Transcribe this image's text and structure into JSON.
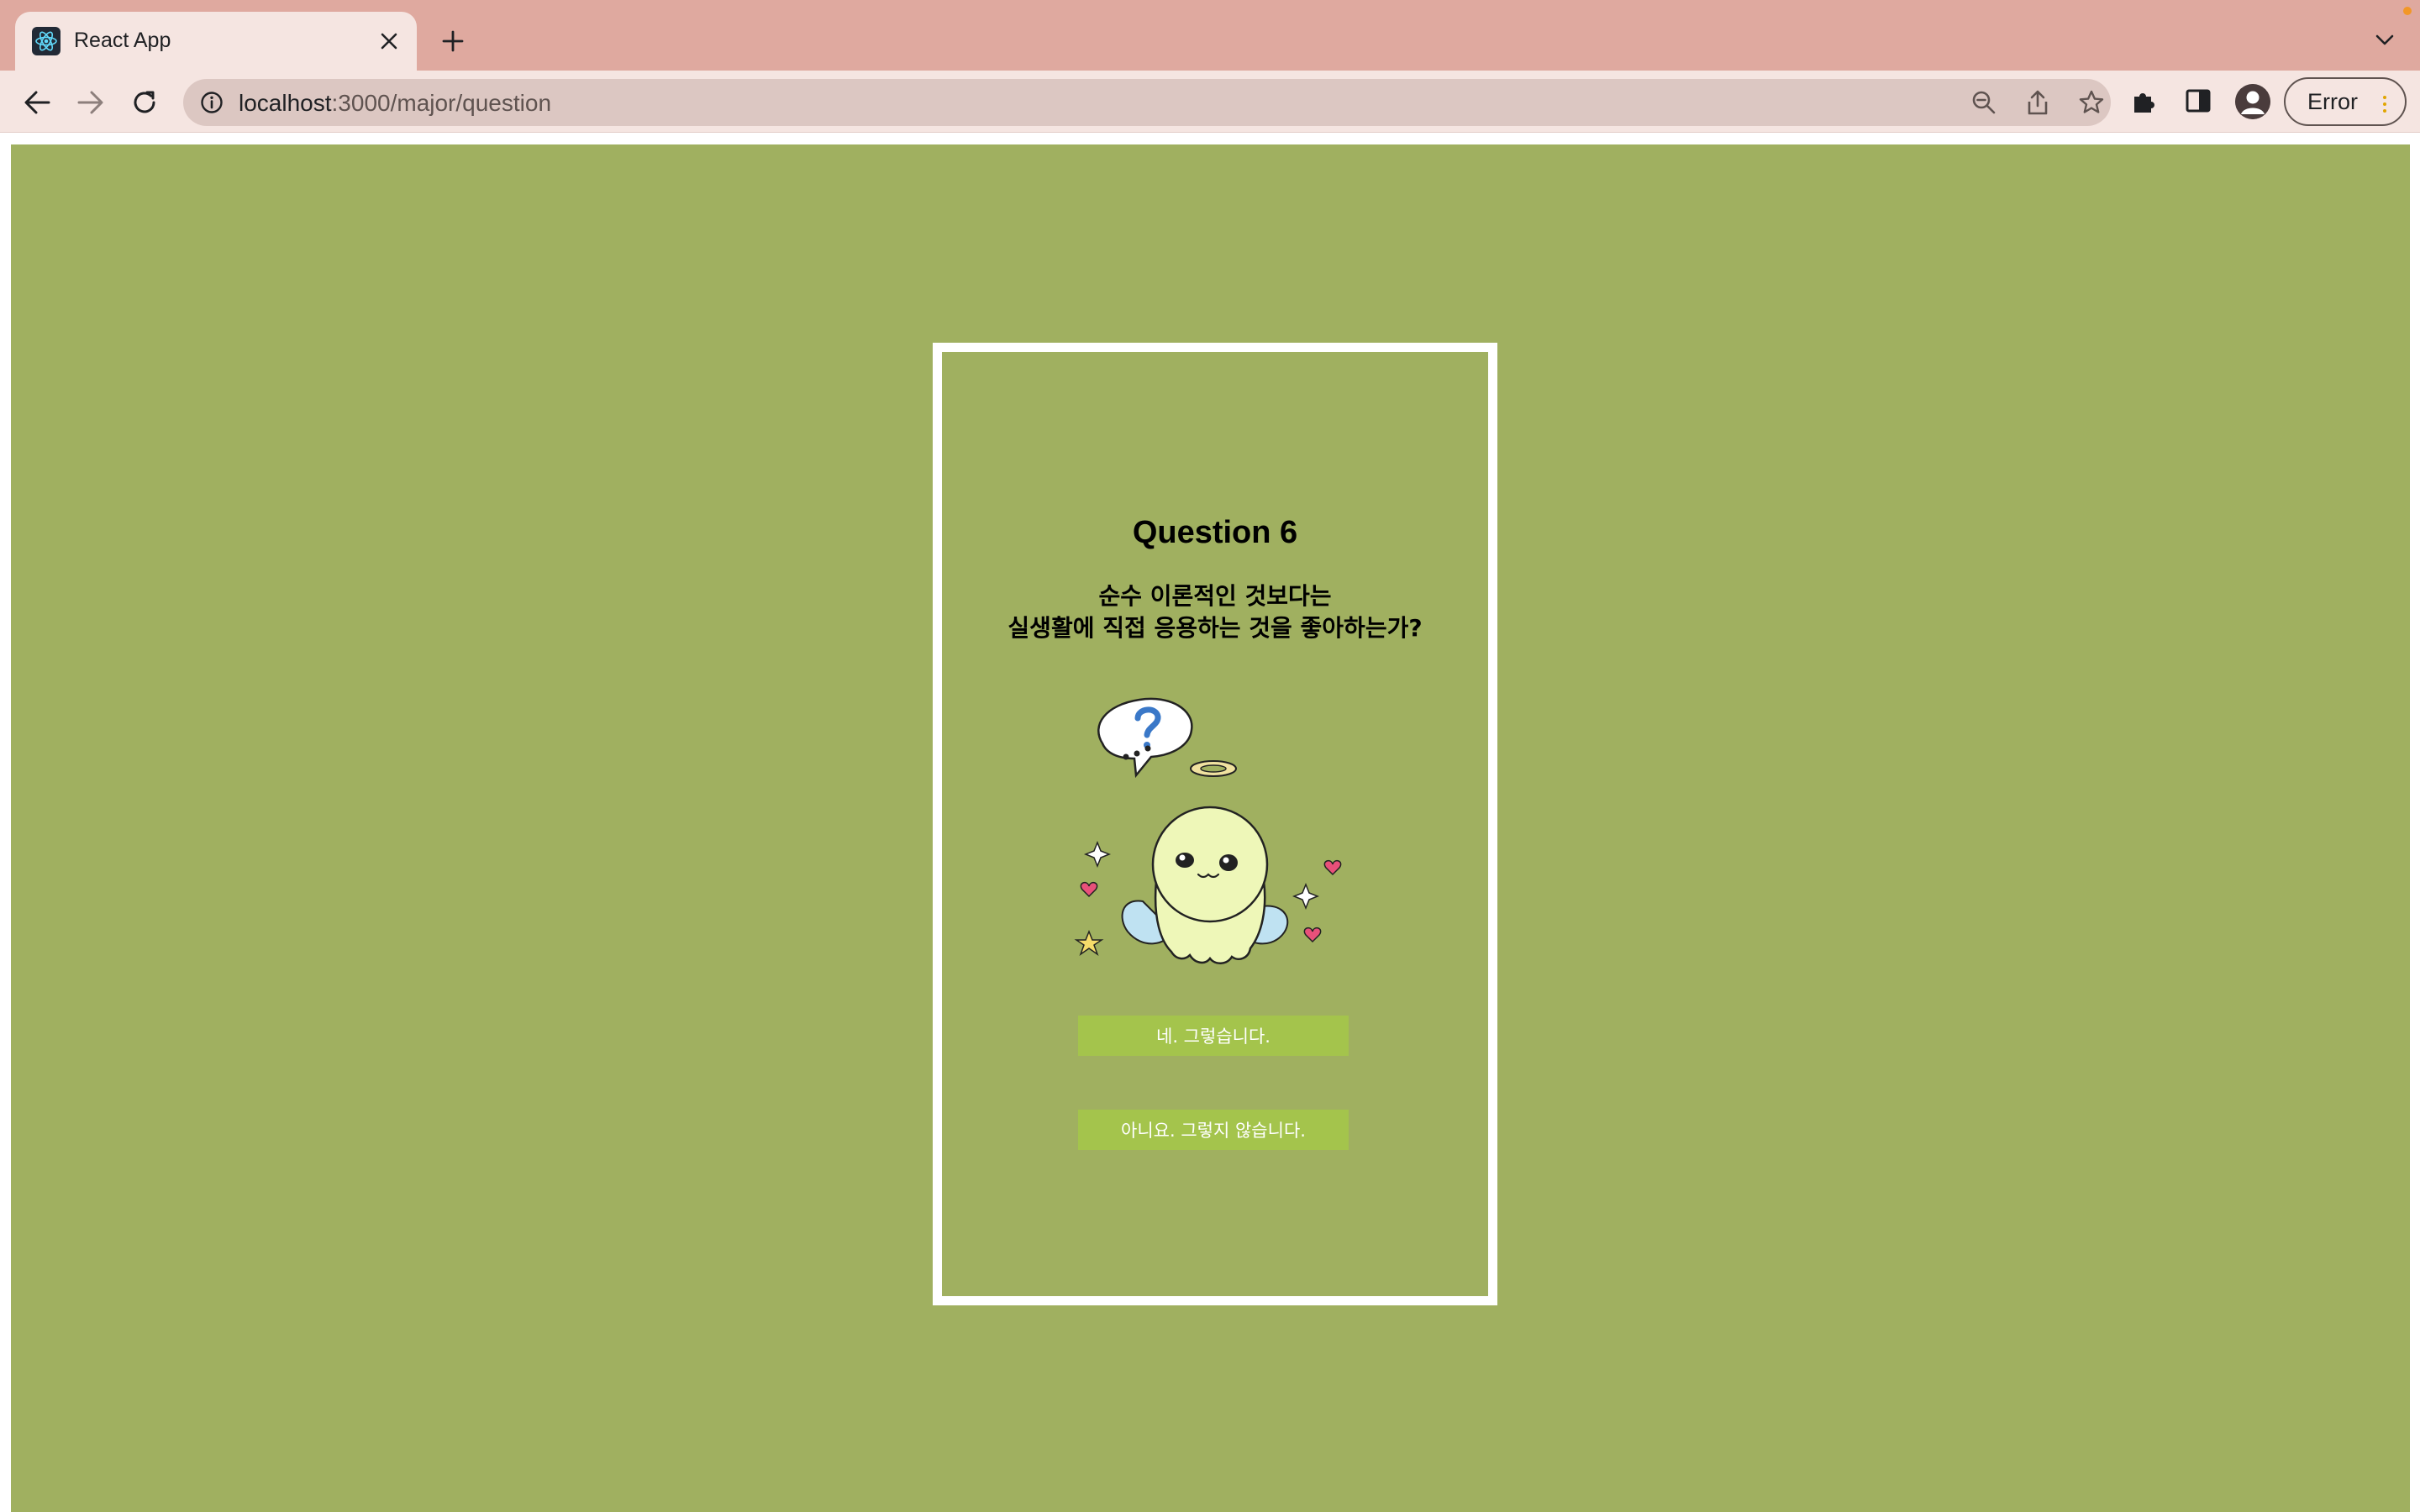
{
  "browser": {
    "tab_title": "React App",
    "url_host": "localhost",
    "url_path": ":3000/major/question",
    "profile_status": "Error",
    "colors": {
      "tab_strip": "#dfa99f",
      "toolbar": "#f5e5e1",
      "omnibox": "#dcc7c2"
    },
    "icons": [
      "react-icon",
      "close-icon",
      "plus-icon",
      "chevron-down-icon",
      "back-arrow-icon",
      "forward-arrow-icon",
      "reload-icon",
      "info-icon",
      "zoom-out-icon",
      "share-icon",
      "star-icon",
      "puzzle-icon",
      "side-panel-icon",
      "profile-icon"
    ]
  },
  "page": {
    "background_color": "#a0b060",
    "card_border_color": "#ffffff",
    "question_title": "Question 6",
    "question_line1": "순수 이론적인 것보다는",
    "question_line2": "실생활에 직접 응용하는 것을 좋아하는가?",
    "answer_yes": "네. 그렇습니다.",
    "answer_no": "아니요. 그렇지 않습니다.",
    "button_color": "#a4c44c"
  }
}
